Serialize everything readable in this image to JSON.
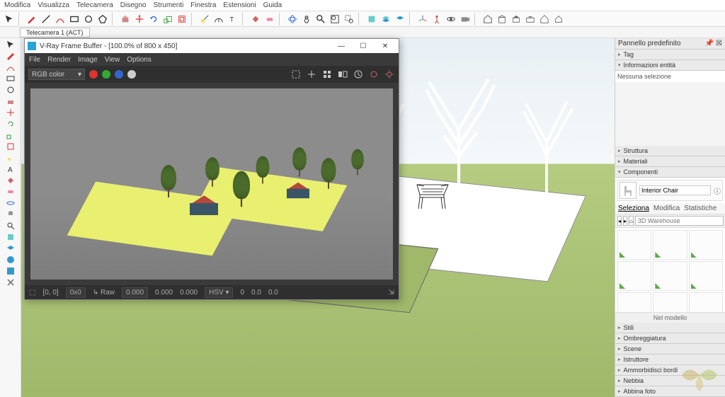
{
  "menubar": [
    "Modifica",
    "Visualizza",
    "Telecamera",
    "Disegno",
    "Strumenti",
    "Finestra",
    "Estensioni",
    "Guida"
  ],
  "scene_tab": "Telecamera 1 (ACT)",
  "vfb": {
    "title": "V-Ray Frame Buffer - [100.0% of 800 x 450]",
    "menu": [
      "File",
      "Render",
      "Image",
      "View",
      "Options"
    ],
    "channel": "RGB color",
    "status": {
      "coords": "[0, 0]",
      "dim": "0x0",
      "raw_label": "Raw",
      "raw_vals": [
        "0.000",
        "0.000",
        "0.000"
      ],
      "hsv_label": "HSV",
      "hsv_vals": [
        "0",
        "0.0",
        "0.0"
      ]
    }
  },
  "right": {
    "default_panel": "Pannello predefinito",
    "tag": "Tag",
    "entity_info": "Informazioni entità",
    "no_selection": "Nessuna selezione",
    "sections": {
      "struttura": "Struttura",
      "materiali": "Materiali",
      "componenti": "Componenti"
    },
    "component_name": "Interior Chair",
    "tabs": {
      "seleziona": "Seleziona",
      "modifica": "Modifica",
      "statistiche": "Statistiche"
    },
    "search_placeholder": "3D Warehouse",
    "bottom_label": "Nel modello",
    "accordion": [
      "Stili",
      "Ombreggiatura",
      "Scene",
      "Istruttore",
      "Ammorbidisci bordi",
      "Nebbia",
      "Abbina foto"
    ]
  }
}
